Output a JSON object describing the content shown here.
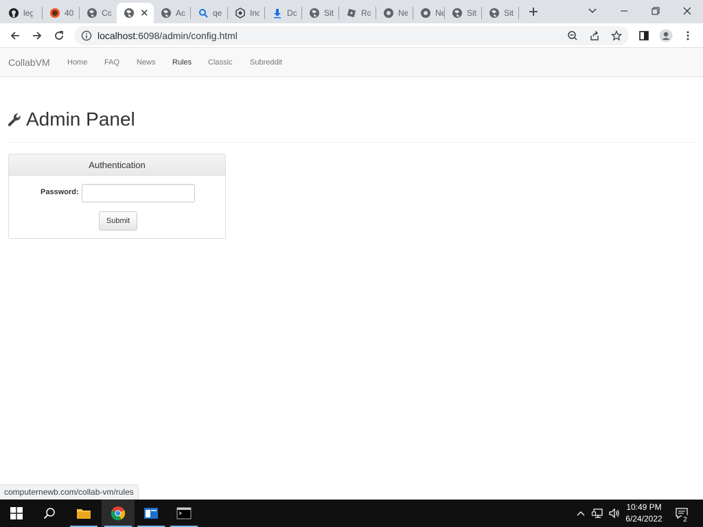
{
  "browser": {
    "tabs": [
      {
        "title": "leg",
        "icon": "github-icon"
      },
      {
        "title": "40",
        "icon": "app-logo-icon"
      },
      {
        "title": "Co",
        "icon": "globe-icon"
      },
      {
        "title": "",
        "icon": "globe-icon",
        "active": true
      },
      {
        "title": "Ac",
        "icon": "globe-icon"
      },
      {
        "title": "qe",
        "icon": "search-icon"
      },
      {
        "title": "Inc",
        "icon": "bundle-icon"
      },
      {
        "title": "Dc",
        "icon": "download-icon"
      },
      {
        "title": "Sit",
        "icon": "globe-icon"
      },
      {
        "title": "Ro",
        "icon": "roblox-icon"
      },
      {
        "title": "Ne",
        "icon": "chrome-icon"
      },
      {
        "title": "Ne",
        "icon": "chrome-icon"
      },
      {
        "title": "Sit",
        "icon": "globe-icon"
      },
      {
        "title": "Sit",
        "icon": "globe-icon"
      }
    ],
    "url_host": "localhost",
    "url_path": ":6098/admin/config.html",
    "status_text": "computernewb.com/collab-vm/rules"
  },
  "navbar": {
    "brand": "CollabVM",
    "links": [
      "Home",
      "FAQ",
      "News",
      "Rules",
      "Classic",
      "Subreddit"
    ],
    "hovered": "Rules"
  },
  "page": {
    "title": "Admin Panel",
    "panel": {
      "heading": "Authentication",
      "password_label": "Password:",
      "password_value": "",
      "submit_label": "Submit"
    }
  },
  "taskbar": {
    "time": "10:49 PM",
    "date": "6/24/2022",
    "notifications": "2"
  },
  "colors": {
    "tabstrip": "#dee1e6",
    "navbar_bg": "#f8f8f8",
    "taskbar": "#101010",
    "accent": "#76b9ed"
  }
}
